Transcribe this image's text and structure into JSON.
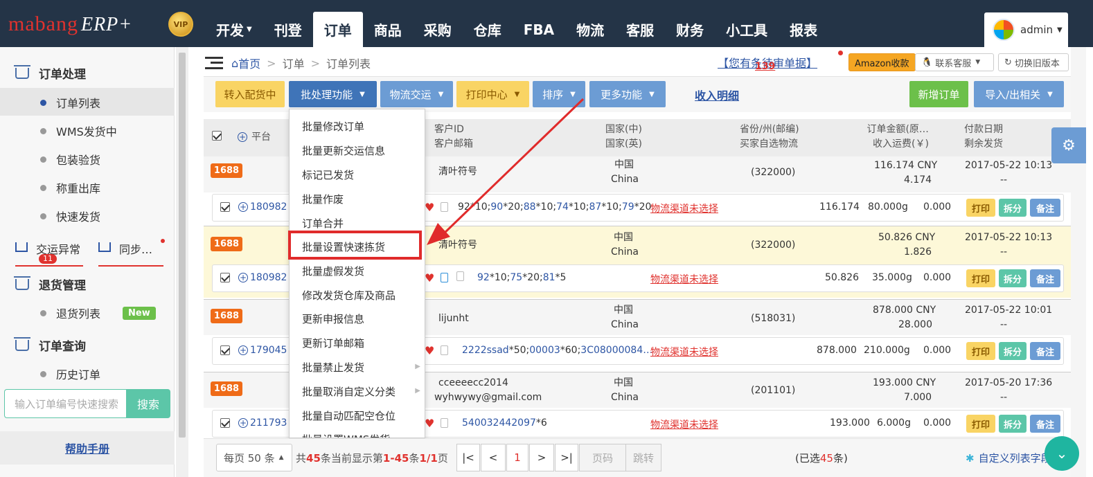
{
  "brand": {
    "name": "mabang",
    "product": "ERP+",
    "vip": "VIP"
  },
  "nav": [
    {
      "label": "开发",
      "caret": true
    },
    {
      "label": "刊登"
    },
    {
      "label": "订单",
      "active": true
    },
    {
      "label": "商品"
    },
    {
      "label": "采购"
    },
    {
      "label": "仓库"
    },
    {
      "label": "FBA"
    },
    {
      "label": "物流"
    },
    {
      "label": "客服"
    },
    {
      "label": "财务"
    },
    {
      "label": "小工具"
    },
    {
      "label": "报表"
    }
  ],
  "user": {
    "name": "admin"
  },
  "sidebar": {
    "sections": [
      {
        "title": "订单处理"
      },
      {
        "title": "退货管理"
      },
      {
        "title": "订单查询"
      }
    ],
    "items": [
      {
        "label": "订单列表"
      },
      {
        "label": "WMS发货中"
      },
      {
        "label": "包装验货"
      },
      {
        "label": "称重出库"
      },
      {
        "label": "快速发货"
      }
    ],
    "exceptions": {
      "label": "交运异常",
      "count": "11",
      "sync": "同步…"
    },
    "returns": {
      "label": "退货列表",
      "badge": "New"
    },
    "query": {
      "label": "历史订单"
    },
    "search": {
      "placeholder": "输入订单编号快速搜索",
      "button": "搜索"
    },
    "help": "帮助手册"
  },
  "breadcrumb": {
    "home": "首页",
    "level1": "订单",
    "level2": "订单列表"
  },
  "pending": {
    "prefix": "【您有",
    "count": "139",
    "suffix": "条待审单据】"
  },
  "header_buttons": {
    "amazon": "Amazon收款",
    "service": "联系客服",
    "version": "切换旧版本"
  },
  "toolbar": {
    "transfer": "转入配货中",
    "batch": "批处理功能",
    "logistics": "物流交运",
    "print": "打印中心",
    "sort": "排序",
    "more": "更多功能",
    "income": "收入明细",
    "new_order": "新增订单",
    "import_export": "导入/出相关"
  },
  "table_head": {
    "platform": "平台",
    "customer_id": "客户ID",
    "customer_email": "客户邮箱",
    "country_cn": "国家(中)",
    "country_en": "国家(英)",
    "province": "省份/州(邮编)",
    "buyer_logistics": "买家自选物流",
    "amount": "订单金额(原…",
    "income_freight": "收入运费(￥)",
    "pay_date": "付款日期",
    "remaining": "剩余发货"
  },
  "orders": [
    {
      "platform": "1688",
      "id": "180982",
      "customer": "清叶符号",
      "email": "",
      "country_cn": "中国",
      "country_en": "China",
      "zip": "(322000)",
      "amount": "116.174 CNY",
      "freight": "4.174",
      "date": "2017-05-22 10:13",
      "remain": "--",
      "items": [
        "92",
        "*10;",
        "90",
        "*20;",
        "88",
        "*10;",
        "74",
        "*10;",
        "87",
        "*10;",
        "79",
        "*20"
      ],
      "logistics": "物流渠道未选择",
      "total": "116.174",
      "weight": "80.000g",
      "fee": "0.000"
    },
    {
      "platform": "1688",
      "id": "180982",
      "customer": "清叶符号",
      "email": "",
      "country_cn": "中国",
      "country_en": "China",
      "zip": "(322000)",
      "amount": "50.826 CNY",
      "freight": "1.826",
      "date": "2017-05-22 10:13",
      "remain": "--",
      "items": [
        "92",
        "*10;",
        "75",
        "*20;",
        "81",
        "*5"
      ],
      "logistics": "物流渠道未选择",
      "total": "50.826",
      "weight": "35.000g",
      "fee": "0.000"
    },
    {
      "platform": "1688",
      "id": "179045",
      "customer": "lijunht",
      "email": "",
      "country_cn": "中国",
      "country_en": "China",
      "zip": "(518031)",
      "amount": "878.000 CNY",
      "freight": "28.000",
      "date": "2017-05-22 10:01",
      "remain": "--",
      "items": [
        "2222ssad",
        "*50;",
        "00003",
        "*60;",
        "3C08000084…"
      ],
      "logistics": "物流渠道未选择",
      "total": "878.000",
      "weight": "210.000g",
      "fee": "0.000"
    },
    {
      "platform": "1688",
      "id": "211793",
      "customer": "cceeeecc2014",
      "email": "wyhwywy@gmail.com",
      "country_cn": "中国",
      "country_en": "China",
      "zip": "(201101)",
      "amount": "193.000 CNY",
      "freight": "7.000",
      "date": "2017-05-20 17:36",
      "remain": "--",
      "items": [
        "540032442097",
        "*6"
      ],
      "logistics": "物流渠道未选择",
      "total": "193.000",
      "weight": "6.000g",
      "fee": "0.000"
    }
  ],
  "row_actions": {
    "print": "打印",
    "split": "拆分",
    "note": "备注"
  },
  "dropdown": [
    "批量修改订单",
    "批量更新交运信息",
    "标记已发货",
    "批量作废",
    "订单合并",
    "批量设置快速拣货",
    "批量虚假发货",
    "修改发货仓库及商品",
    "更新申报信息",
    "更新订单邮箱",
    "批量禁止发货",
    "批量取消自定义分类",
    "批量自动匹配空仓位",
    "批量设置WMS发货"
  ],
  "footer": {
    "per_page": "每页 50 条",
    "summary_a": "共",
    "total": "45",
    "summary_b": "条当前显示第",
    "range": "1-45",
    "summary_c": "条",
    "pages": "1/1",
    "summary_d": "页",
    "current_page": "1",
    "page_input": "页码",
    "jump": "跳转",
    "selected_a": "(已选",
    "selected": "45",
    "selected_b": "条)",
    "custom_fields": "自定义列表字段"
  },
  "colors": {
    "topbar": "#243447",
    "highlight": "#e02b2b",
    "accent": "#2d55a4",
    "tag": "#ef6b18"
  }
}
